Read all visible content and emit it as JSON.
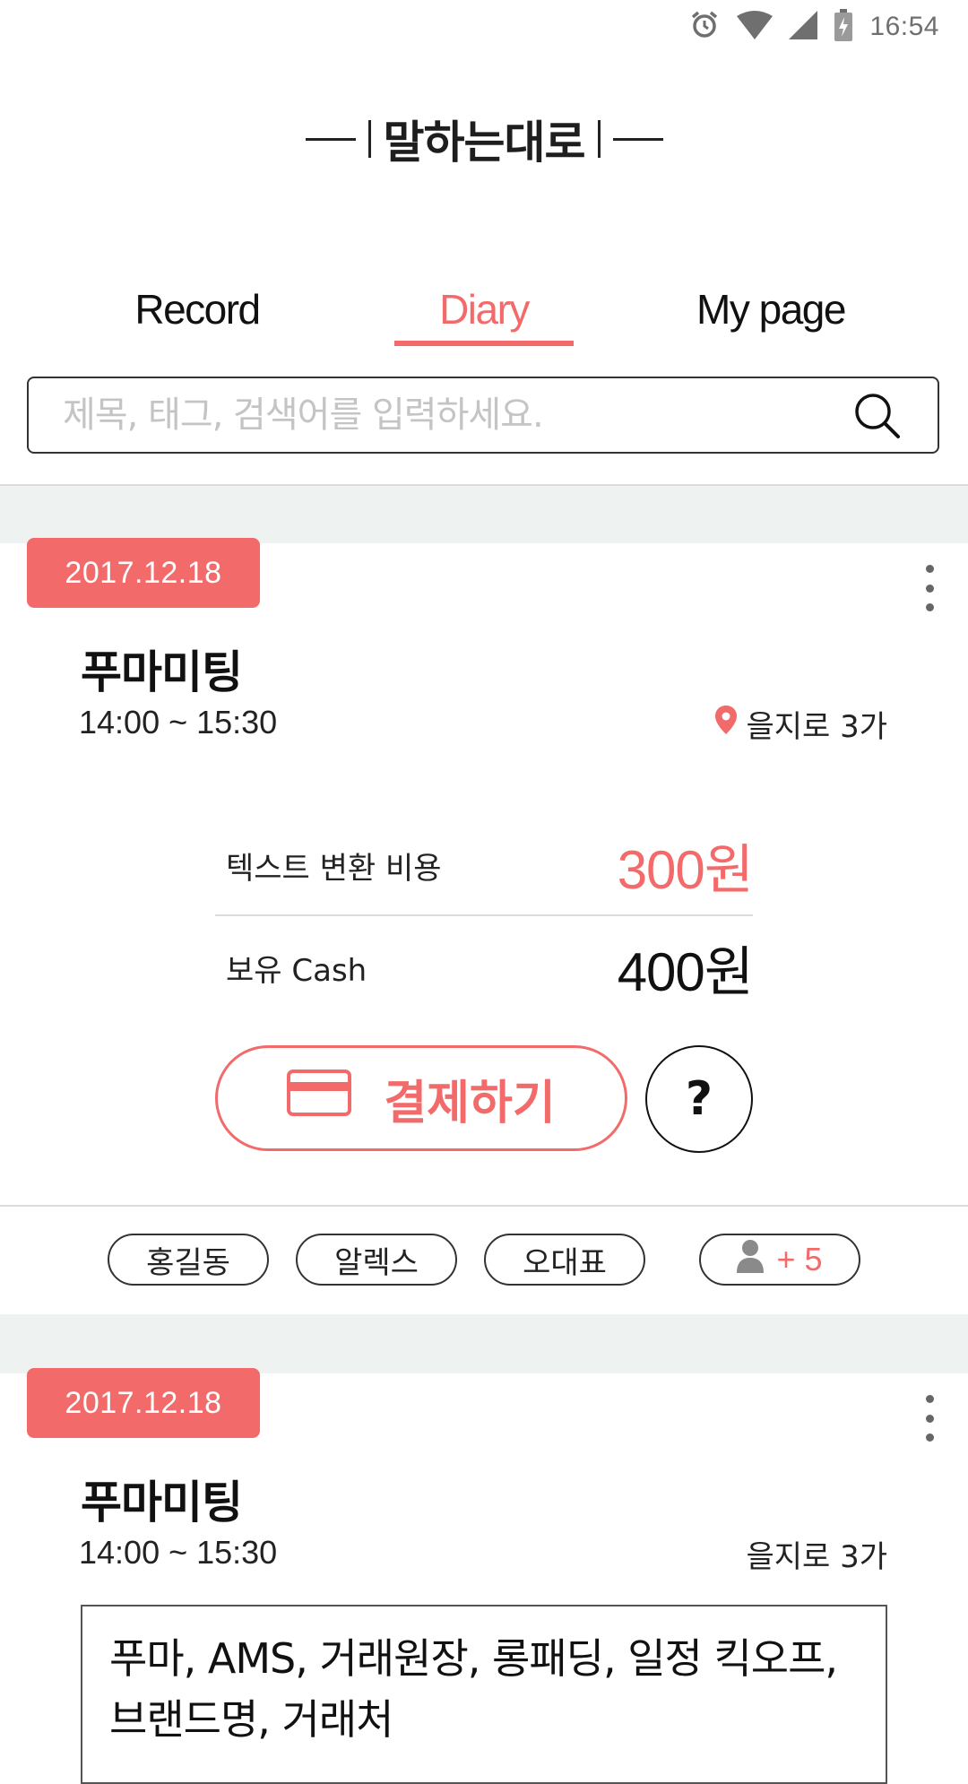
{
  "status_bar": {
    "time": "16:54"
  },
  "app": {
    "title": "말하는대로"
  },
  "tabs": [
    {
      "label": "Record",
      "active": false
    },
    {
      "label": "Diary",
      "active": true
    },
    {
      "label": "My page",
      "active": false
    }
  ],
  "search": {
    "placeholder": "제목, 태그, 검색어를 입력하세요.",
    "value": ""
  },
  "cards": [
    {
      "date": "2017.12.18",
      "title": "푸마미팅",
      "time": "14:00 ~ 15:30",
      "location": "을지로 3가",
      "fee_label": "텍스트 변환 비용",
      "fee_value": "300원",
      "cash_label": "보유 Cash",
      "cash_value": "400원",
      "pay_label": "결제하기",
      "help_label": "?",
      "participants": [
        "홍길동",
        "알렉스",
        "오대표"
      ],
      "more_participants": "+ 5"
    },
    {
      "date": "2017.12.18",
      "title": "푸마미팅",
      "time": "14:00 ~ 15:30",
      "location": "을지로 3가",
      "tags_text": "푸마, AMS, 거래원장, 롱패딩, 일정 킥오프, 브랜드명, 거래처"
    }
  ],
  "colors": {
    "accent": "#f26a6a",
    "band": "#eef2f1",
    "text": "#111111"
  }
}
